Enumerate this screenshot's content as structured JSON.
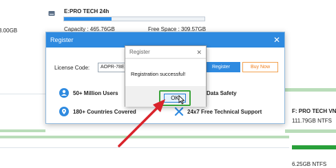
{
  "background": {
    "left_fragment": "3.00GB",
    "drive_label": "E:PRO TECH 24h",
    "capacity_text": "Capacity : 465.76GB",
    "free_space_text": "Free Space : 309.57GB",
    "drive_usage_fraction": 0.34,
    "right_drive_label": "F: PRO TECH VN",
    "right_drive_size": "111.79GB NTFS",
    "bottom_right_fragment": "6.25GB NTFS"
  },
  "register": {
    "title": "Register",
    "license_label": "License Code:",
    "license_value": "AOPR-78E",
    "register_button": "Register",
    "buy_now_button": "Buy Now",
    "features": [
      {
        "icon": "users-icon",
        "text": "50+ Million Users"
      },
      {
        "icon": "shield-icon",
        "text": "Data Safety"
      },
      {
        "icon": "location-icon",
        "text": "180+ Countries Covered"
      },
      {
        "icon": "tools-icon",
        "text": "24x7 Free Technical Support"
      }
    ]
  },
  "dialog": {
    "title": "Register",
    "message": "Registration successful!",
    "ok_button": "OK"
  },
  "colors": {
    "accent_blue": "#2e8ae0",
    "buy_orange": "#f07d1a",
    "annotation_red": "#d9232b",
    "highlight_green": "#3aa33a"
  }
}
